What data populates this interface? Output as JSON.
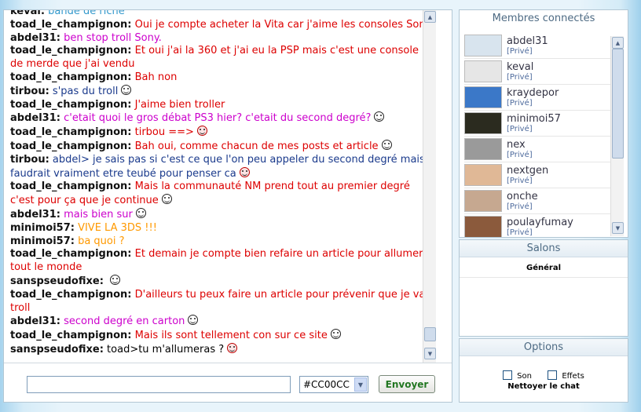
{
  "chat": {
    "messages": [
      {
        "nick": "keval:",
        "text": "bande de riche",
        "color": "#3399cc",
        "smiley": false
      },
      {
        "nick": "toad_le_champignon:",
        "text": "Oui je compte acheter la Vita car j'aime les consoles Sony",
        "color": "#dd0000",
        "smiley": false
      },
      {
        "nick": "abdel31:",
        "text": "ben stop troll Sony.",
        "color": "#cc00cc",
        "smiley": false
      },
      {
        "nick": "toad_le_champignon:",
        "text": "Et oui j'ai la 360 et j'ai eu la PSP mais c'est une console de merde que j'ai vendu",
        "color": "#dd0000",
        "smiley": false
      },
      {
        "nick": "toad_le_champignon:",
        "text": "Bah non",
        "color": "#dd0000",
        "smiley": false
      },
      {
        "nick": "tirbou:",
        "text": "s'pas du troll",
        "color": "#1a3a8c",
        "smiley": true,
        "smiley_type": "normal"
      },
      {
        "nick": "toad_le_champignon:",
        "text": "J'aime bien troller",
        "color": "#dd0000",
        "smiley": false
      },
      {
        "nick": "abdel31:",
        "text": "c'etait quoi le gros débat PS3 hier? c'etait du second degré?",
        "color": "#cc00cc",
        "smiley": true,
        "smiley_type": "normal"
      },
      {
        "nick": "toad_le_champignon:",
        "text": "tirbou ==>",
        "color": "#dd0000",
        "smiley": true,
        "smiley_type": "red"
      },
      {
        "nick": "toad_le_champignon:",
        "text": "Bah oui, comme chacun de mes posts et article",
        "color": "#dd0000",
        "smiley": true,
        "smiley_type": "normal"
      },
      {
        "nick": "tirbou:",
        "text": "abdel> je sais pas si c'est ce que l'on peu appeler du second degré mais faudrait vraiment etre teubé pour penser ca",
        "color": "#1a3a8c",
        "smiley": true,
        "smiley_type": "red"
      },
      {
        "nick": "toad_le_champignon:",
        "text": "Mais la communauté NM prend tout au premier degré c'est pour ça que je continue",
        "color": "#dd0000",
        "smiley": true,
        "smiley_type": "normal"
      },
      {
        "nick": "abdel31:",
        "text": "mais bien sur",
        "color": "#cc00cc",
        "smiley": true,
        "smiley_type": "normal"
      },
      {
        "nick": "minimoi57:",
        "text": "VIVE LA 3DS !!!",
        "color": "#ff9900",
        "smiley": false
      },
      {
        "nick": "minimoi57:",
        "text": "ba quoi ?",
        "color": "#ff9900",
        "smiley": false
      },
      {
        "nick": "toad_le_champignon:",
        "text": "Et demain je compte bien refaire un article pour allumer tout le monde",
        "color": "#dd0000",
        "smiley": false
      },
      {
        "nick": "sanspseudofixe:",
        "text": "",
        "color": "#000000",
        "smiley": true,
        "smiley_type": "normal"
      },
      {
        "nick": "toad_le_champignon:",
        "text": "D'ailleurs tu peux faire un article pour prévenir que je vais troll",
        "color": "#dd0000",
        "smiley": false
      },
      {
        "nick": "abdel31:",
        "text": "second degré en carton",
        "color": "#cc00cc",
        "smiley": true,
        "smiley_type": "normal"
      },
      {
        "nick": "toad_le_champignon:",
        "text": "Mais ils sont tellement con sur ce site",
        "color": "#dd0000",
        "smiley": true,
        "smiley_type": "normal"
      },
      {
        "nick": "sanspseudofixe:",
        "text": "toad>tu m'allumeras ?",
        "color": "#000000",
        "smiley": true,
        "smiley_type": "red"
      }
    ]
  },
  "composer": {
    "color_value": "#CC00CC",
    "send_label": "Envoyer"
  },
  "members": {
    "title": "Membres connectés",
    "list": [
      {
        "name": "abdel31",
        "priv": "[Privé]",
        "avatar_color": "#d8e4ee"
      },
      {
        "name": "keval",
        "priv": "[Privé]",
        "avatar_color": "#e6e6e6"
      },
      {
        "name": "kraydepor",
        "priv": "[Privé]",
        "avatar_color": "#3b78c8"
      },
      {
        "name": "minimoi57",
        "priv": "[Privé]",
        "avatar_color": "#2b2b1f"
      },
      {
        "name": "nex",
        "priv": "[Privé]",
        "avatar_color": "#9a9a9a"
      },
      {
        "name": "nextgen",
        "priv": "[Privé]",
        "avatar_color": "#e0b896"
      },
      {
        "name": "onche",
        "priv": "[Privé]",
        "avatar_color": "#c6a890"
      },
      {
        "name": "poulayfumay",
        "priv": "[Privé]",
        "avatar_color": "#8b5a3c"
      }
    ]
  },
  "salons": {
    "title": "Salons",
    "items": [
      "Général"
    ]
  },
  "options": {
    "title": "Options",
    "sound_label": "Son",
    "effects_label": "Effets",
    "clear_label": "Nettoyer le chat"
  }
}
